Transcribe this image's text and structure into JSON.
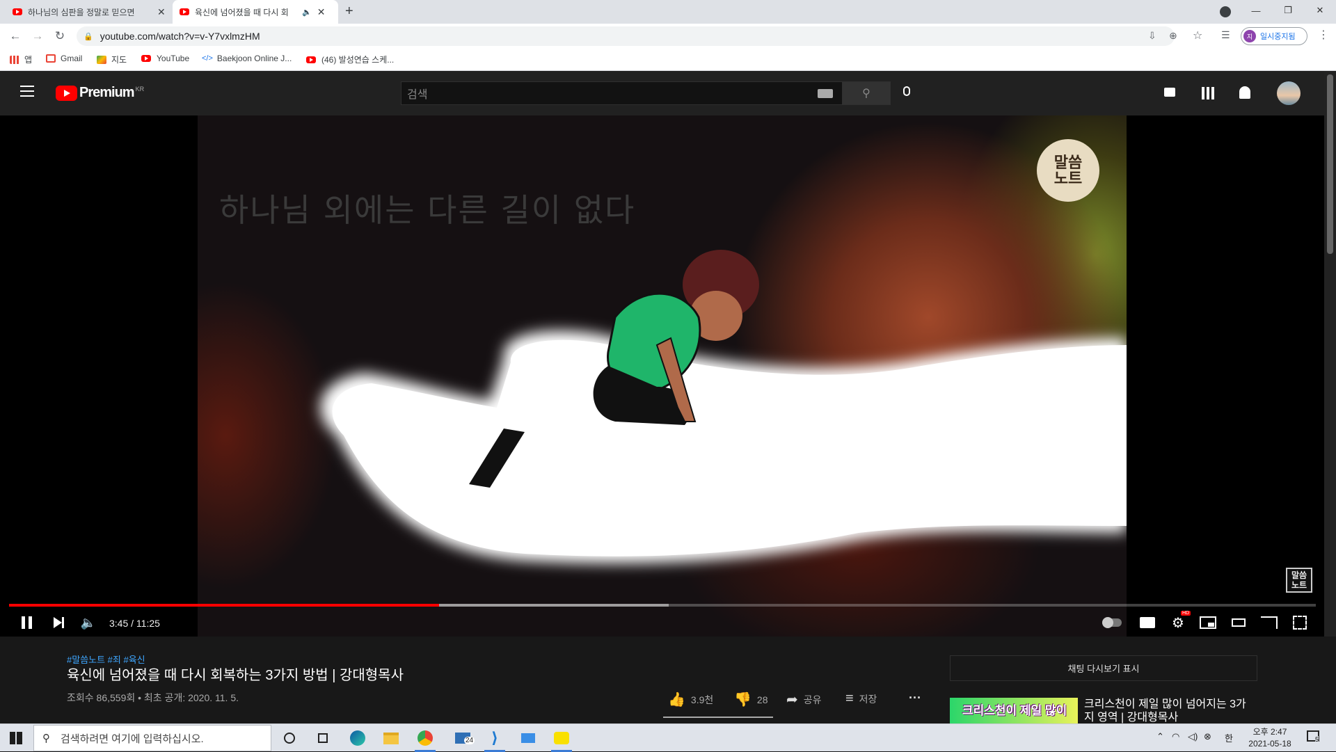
{
  "browser": {
    "tabs": [
      {
        "title": "하나님의 심판을 정말로 믿으면",
        "active": false
      },
      {
        "title": "육신에 넘어졌을 때 다시 회",
        "active": true
      }
    ],
    "url": "youtube.com/watch?v=v-Y7vxlmzHM",
    "profile_label": "일시중지됨",
    "profile_initial": "지",
    "new_tab": "+"
  },
  "bookmarks": [
    {
      "label": "앱",
      "icon": "apps-grid-icon",
      "color": "#ea4335"
    },
    {
      "label": "Gmail",
      "icon": "gmail-icon",
      "color": "#ea4335"
    },
    {
      "label": "지도",
      "icon": "maps-icon",
      "color": "#34a853"
    },
    {
      "label": "YouTube",
      "icon": "youtube-icon",
      "color": "#ff0000"
    },
    {
      "label": "Baekjoon Online J...",
      "icon": "baekjoon-icon",
      "color": "#1a73e8"
    },
    {
      "label": "(46) 발성연습 스케...",
      "icon": "youtube-icon",
      "color": "#ff0000"
    }
  ],
  "youtube": {
    "logo_text": "Premium",
    "logo_region": "KR",
    "search_placeholder": "검색"
  },
  "player": {
    "overlay_text": "하나님 외에는 다른 길이 없다",
    "channel_badge": [
      "말씀",
      "노트"
    ],
    "watermark": [
      "말씀",
      "노트"
    ],
    "time": "3:45 / 11:25",
    "progress_fraction": 0.329,
    "buffered_fraction": 0.505,
    "hd_badge": "HD"
  },
  "video": {
    "hashtags": "#말씀노트 #죄 #육신",
    "title": "육신에 넘어졌을 때 다시 회복하는 3가지 방법 | 강대형목사",
    "meta": "조회수 86,559회 • 최초 공개: 2020. 11. 5.",
    "likes": "3.9천",
    "dislikes": "28",
    "share": "공유",
    "save": "저장",
    "more": "···"
  },
  "sidebar": {
    "chat_replay": "채팅 다시보기 표시",
    "reco_thumb_text": "크리스천이 제일 많이",
    "reco_title": "크리스천이 제일 많이 넘어지는 3가지 영역 | 강대형목사"
  },
  "taskbar": {
    "search_placeholder": "검색하려면 여기에 입력하십시오.",
    "mail_badge": "24",
    "ime": "한",
    "clock_time": "오후 2:47",
    "clock_date": "2021-05-18",
    "notification_count": "5"
  }
}
